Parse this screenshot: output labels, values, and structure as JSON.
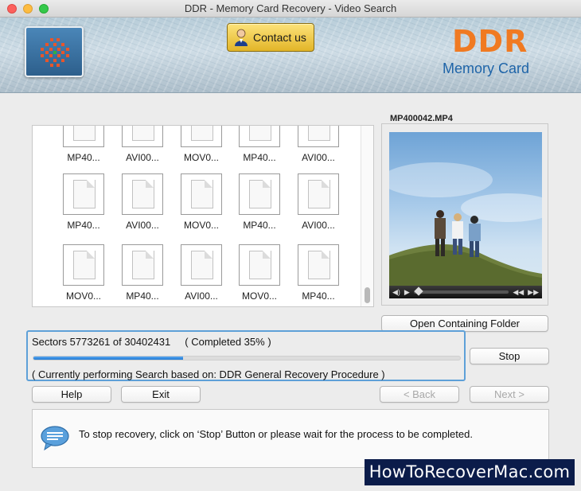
{
  "window": {
    "title": "DDR - Memory Card Recovery - Video Search"
  },
  "header": {
    "contact_label": "Contact us",
    "brand_title": "DDR",
    "brand_subtitle": "Memory Card"
  },
  "files": [
    [
      "MP40...",
      "AVI00...",
      "MOV0...",
      "MP40...",
      "AVI00..."
    ],
    [
      "MP40...",
      "AVI00...",
      "MOV0...",
      "MP40...",
      "AVI00..."
    ],
    [
      "MOV0...",
      "MP40...",
      "AVI00...",
      "MOV0...",
      "MP40..."
    ]
  ],
  "preview": {
    "filename": "MP400042.MP4",
    "open_folder_label": "Open Containing Folder"
  },
  "progress": {
    "sectors_text": "Sectors 5773261 of 30402431",
    "completed_text": "( Completed 35% )",
    "fraction": 0.35,
    "status_text": "( Currently performing Search based on: DDR General Recovery Procedure )"
  },
  "buttons": {
    "stop": "Stop",
    "help": "Help",
    "exit": "Exit",
    "back": "< Back",
    "next": "Next >"
  },
  "info": {
    "message": "To stop recovery, click on ‘Stop’ Button or please wait for the process to be completed."
  },
  "watermark": "HowToRecoverMac.com",
  "colors": {
    "accent": "#5ea0d8",
    "progress_fill": "#1f7ad6",
    "brand_orange": "#f07a22",
    "brand_blue": "#1e64a8"
  }
}
